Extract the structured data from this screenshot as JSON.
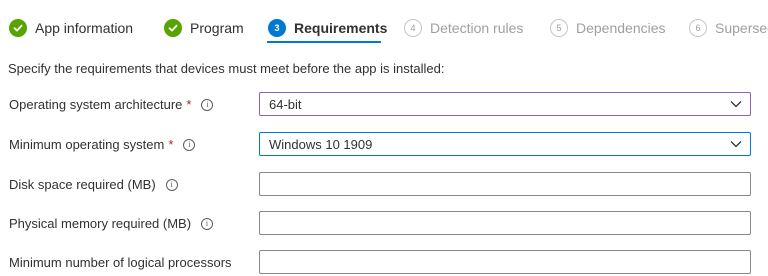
{
  "wizard": {
    "steps": [
      {
        "label": "App information",
        "number": "",
        "status": "done"
      },
      {
        "label": "Program",
        "number": "",
        "status": "done"
      },
      {
        "label": "Requirements",
        "number": "3",
        "status": "current"
      },
      {
        "label": "Detection rules",
        "number": "4",
        "status": "todo"
      },
      {
        "label": "Dependencies",
        "number": "5",
        "status": "todo"
      },
      {
        "label": "Supersed",
        "number": "6",
        "status": "todo"
      }
    ]
  },
  "intro": "Specify the requirements that devices must meet before the app is installed:",
  "fields": {
    "os_arch": {
      "label": "Operating system architecture",
      "required": "*",
      "value": "64-bit"
    },
    "min_os": {
      "label": "Minimum operating system",
      "required": "*",
      "value": "Windows 10 1909"
    },
    "disk_space": {
      "label": "Disk space required (MB)",
      "value": ""
    },
    "memory": {
      "label": "Physical memory required (MB)",
      "value": ""
    },
    "processors": {
      "label": "Minimum number of logical processors",
      "value": ""
    }
  },
  "icons": {
    "info": "i",
    "check": "check-icon",
    "chevron": "chevron-down-icon"
  },
  "colors": {
    "done": "#57a300",
    "current": "#0078d4",
    "required": "#a4262c",
    "focus_purple": "#8764b8"
  }
}
